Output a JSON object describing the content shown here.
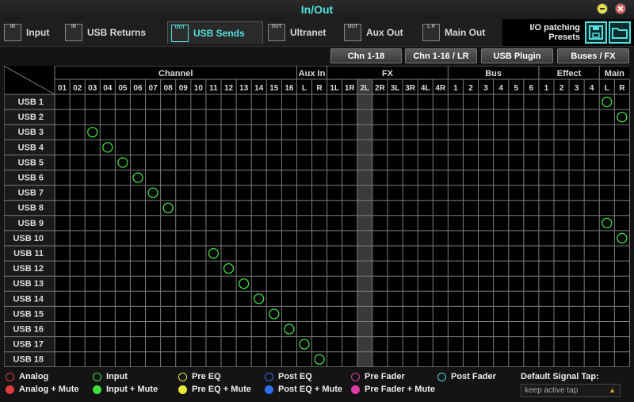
{
  "window": {
    "title": "In/Out"
  },
  "tabs": [
    {
      "label": "Input",
      "icon": "input-icon",
      "icon_text": "IN"
    },
    {
      "label": "USB Returns",
      "icon": "usb-returns-icon",
      "icon_text": "IN"
    },
    {
      "label": "USB Sends",
      "icon": "usb-sends-icon",
      "icon_text": "OUT",
      "active": true
    },
    {
      "label": "Ultranet",
      "icon": "ultranet-icon",
      "icon_text": "OUT"
    },
    {
      "label": "Aux Out",
      "icon": "aux-out-icon",
      "icon_text": "OUT"
    },
    {
      "label": "Main Out",
      "icon": "main-out-icon",
      "icon_text": "L R"
    }
  ],
  "presets": {
    "label": "I/O patching\nPresets",
    "save_icon": "save-icon",
    "open_icon": "folder-icon"
  },
  "source_buttons": [
    "Chn 1-18",
    "Chn 1-16 / LR",
    "USB Plugin",
    "Buses / FX"
  ],
  "groups": [
    "Channel",
    "Aux In",
    "FX",
    "Bus",
    "Effect",
    "Main"
  ],
  "columns": [
    "01",
    "02",
    "03",
    "04",
    "05",
    "06",
    "07",
    "08",
    "09",
    "10",
    "11",
    "12",
    "13",
    "14",
    "15",
    "16",
    "L",
    "R",
    "1L",
    "1R",
    "2L",
    "2R",
    "3L",
    "3R",
    "4L",
    "4R",
    "1",
    "2",
    "3",
    "4",
    "5",
    "6",
    "1",
    "2",
    "3",
    "4",
    "L",
    "R"
  ],
  "rows": [
    "USB 1",
    "USB 2",
    "USB 3",
    "USB 4",
    "USB 5",
    "USB 6",
    "USB 7",
    "USB 8",
    "USB 9",
    "USB 10",
    "USB 11",
    "USB 12",
    "USB 13",
    "USB 14",
    "USB 15",
    "USB 16",
    "USB 17",
    "USB 18"
  ],
  "patches": [
    {
      "row": "USB 1",
      "col": "L (Main)",
      "type": "Input"
    },
    {
      "row": "USB 2",
      "col": "R (Main)",
      "type": "Input"
    },
    {
      "row": "USB 3",
      "col": "03",
      "type": "Input"
    },
    {
      "row": "USB 4",
      "col": "04",
      "type": "Input"
    },
    {
      "row": "USB 5",
      "col": "05",
      "type": "Input"
    },
    {
      "row": "USB 6",
      "col": "06",
      "type": "Input"
    },
    {
      "row": "USB 7",
      "col": "07",
      "type": "Input"
    },
    {
      "row": "USB 8",
      "col": "08",
      "type": "Input"
    },
    {
      "row": "USB 9",
      "col": "L (Main)",
      "type": "Input"
    },
    {
      "row": "USB 10",
      "col": "R (Main)",
      "type": "Input"
    },
    {
      "row": "USB 11",
      "col": "11",
      "type": "Input"
    },
    {
      "row": "USB 12",
      "col": "12",
      "type": "Input"
    },
    {
      "row": "USB 13",
      "col": "13",
      "type": "Input"
    },
    {
      "row": "USB 14",
      "col": "14",
      "type": "Input"
    },
    {
      "row": "USB 15",
      "col": "15",
      "type": "Input"
    },
    {
      "row": "USB 16",
      "col": "16",
      "type": "Input"
    },
    {
      "row": "USB 17",
      "col": "L (Aux In)",
      "type": "Input"
    },
    {
      "row": "USB 18",
      "col": "R (Aux In)",
      "type": "Input"
    }
  ],
  "legend": [
    {
      "label": "Analog",
      "color": "#e03c3c",
      "filled": false
    },
    {
      "label": "Input",
      "color": "#3ee03e",
      "filled": false
    },
    {
      "label": "Pre EQ",
      "color": "#e8e83a",
      "filled": false
    },
    {
      "label": "Post EQ",
      "color": "#2f6ef0",
      "filled": false
    },
    {
      "label": "Pre Fader",
      "color": "#e03aa8",
      "filled": false
    },
    {
      "label": "Post Fader",
      "color": "#4ad8e0",
      "filled": false
    },
    {
      "label": "Analog + Mute",
      "color": "#e03c3c",
      "filled": true
    },
    {
      "label": "Input + Mute",
      "color": "#3ee03e",
      "filled": true
    },
    {
      "label": "Pre EQ + Mute",
      "color": "#e8e83a",
      "filled": true
    },
    {
      "label": "Post EQ + Mute",
      "color": "#2f6ef0",
      "filled": true
    },
    {
      "label": "Pre Fader + Mute",
      "color": "#e03aa8",
      "filled": true
    }
  ],
  "signal_tap": {
    "label": "Default Signal Tap:",
    "value": "keep active tap"
  },
  "colors": {
    "accent": "#53e0e0",
    "patch": "#3ee03e",
    "grid_line": "#7d7d7d"
  }
}
